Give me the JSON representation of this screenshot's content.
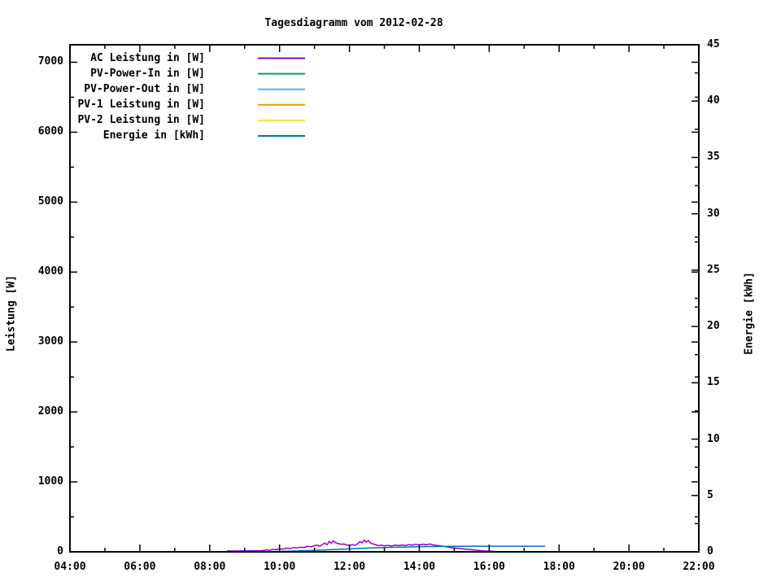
{
  "chart_data": {
    "type": "line",
    "title": "Tagesdiagramm vom 2012-02-28",
    "background": "#ffffff",
    "axis_color": "#000000",
    "grid": false,
    "legend_position": "top-left-inside",
    "x_axis": {
      "range": [
        4,
        22
      ],
      "tick_hours": [
        4,
        6,
        8,
        10,
        12,
        14,
        16,
        18,
        20,
        22
      ],
      "tick_labels": [
        "04:00",
        "06:00",
        "08:00",
        "10:00",
        "12:00",
        "14:00",
        "16:00",
        "18:00",
        "20:00",
        "22:00"
      ],
      "minor_step_hours": 1
    },
    "y_left": {
      "label": "Leistung [W]",
      "range": [
        0,
        7250
      ],
      "tick_values": [
        0,
        1000,
        2000,
        3000,
        4000,
        5000,
        6000,
        7000
      ],
      "tick_labels": [
        "0",
        "1000",
        "2000",
        "3000",
        "4000",
        "5000",
        "6000",
        "7000"
      ],
      "minor_step": 500
    },
    "y_right": {
      "label": "Energie [kWh]",
      "range": [
        0,
        45
      ],
      "tick_values": [
        0,
        5,
        10,
        15,
        20,
        25,
        30,
        35,
        40,
        45
      ],
      "tick_labels": [
        "0",
        "5",
        "10",
        "15",
        "20",
        "25",
        "30",
        "35",
        "40",
        "45"
      ],
      "minor_step": 2.5
    },
    "series": [
      {
        "name": "AC Leistung in [W]",
        "color": "#9400d3",
        "axis": "left",
        "points": [
          [
            8.5,
            15
          ],
          [
            8.7,
            12
          ],
          [
            8.9,
            15
          ],
          [
            9.1,
            13
          ],
          [
            9.3,
            16
          ],
          [
            9.45,
            14
          ],
          [
            9.55,
            20
          ],
          [
            9.65,
            28
          ],
          [
            9.72,
            22
          ],
          [
            9.8,
            35
          ],
          [
            9.9,
            30
          ],
          [
            10.0,
            42
          ],
          [
            10.1,
            38
          ],
          [
            10.2,
            52
          ],
          [
            10.3,
            46
          ],
          [
            10.4,
            60
          ],
          [
            10.5,
            55
          ],
          [
            10.6,
            68
          ],
          [
            10.7,
            62
          ],
          [
            10.8,
            78
          ],
          [
            10.9,
            72
          ],
          [
            11.0,
            88
          ],
          [
            11.08,
            95
          ],
          [
            11.15,
            82
          ],
          [
            11.22,
            105
          ],
          [
            11.3,
            125
          ],
          [
            11.36,
            100
          ],
          [
            11.42,
            148
          ],
          [
            11.48,
            122
          ],
          [
            11.54,
            158
          ],
          [
            11.6,
            132
          ],
          [
            11.68,
            118
          ],
          [
            11.76,
            108
          ],
          [
            11.84,
            112
          ],
          [
            11.92,
            98
          ],
          [
            12.0,
            92
          ],
          [
            12.08,
            102
          ],
          [
            12.16,
            92
          ],
          [
            12.24,
            118
          ],
          [
            12.3,
            148
          ],
          [
            12.36,
            128
          ],
          [
            12.42,
            168
          ],
          [
            12.48,
            138
          ],
          [
            12.54,
            162
          ],
          [
            12.6,
            128
          ],
          [
            12.68,
            112
          ],
          [
            12.76,
            98
          ],
          [
            12.84,
            88
          ],
          [
            12.92,
            95
          ],
          [
            13.0,
            85
          ],
          [
            13.1,
            92
          ],
          [
            13.2,
            82
          ],
          [
            13.3,
            95
          ],
          [
            13.4,
            88
          ],
          [
            13.5,
            98
          ],
          [
            13.6,
            92
          ],
          [
            13.7,
            102
          ],
          [
            13.8,
            95
          ],
          [
            13.9,
            108
          ],
          [
            14.0,
            98
          ],
          [
            14.1,
            108
          ],
          [
            14.2,
            100
          ],
          [
            14.3,
            112
          ],
          [
            14.4,
            98
          ],
          [
            14.5,
            92
          ],
          [
            14.6,
            85
          ],
          [
            14.7,
            78
          ],
          [
            14.8,
            70
          ],
          [
            14.9,
            62
          ],
          [
            15.0,
            55
          ],
          [
            15.15,
            48
          ],
          [
            15.3,
            40
          ],
          [
            15.45,
            32
          ],
          [
            15.6,
            25
          ],
          [
            15.75,
            18
          ],
          [
            15.9,
            12
          ],
          [
            16.05,
            8
          ],
          [
            16.2,
            5
          ],
          [
            16.4,
            4
          ],
          [
            16.7,
            3
          ],
          [
            17.0,
            3
          ],
          [
            17.3,
            2
          ]
        ]
      },
      {
        "name": "PV-Power-In in [W]",
        "color": "#009e73",
        "axis": "left",
        "points": [
          [
            8.5,
            0
          ],
          [
            17.3,
            0
          ]
        ]
      },
      {
        "name": "PV-Power-Out in [W]",
        "color": "#56b4e9",
        "axis": "left",
        "points": [
          [
            8.5,
            0
          ],
          [
            17.3,
            0
          ]
        ]
      },
      {
        "name": "PV-1 Leistung in [W]",
        "color": "#e69f00",
        "axis": "left",
        "points": [
          [
            8.5,
            0
          ],
          [
            17.3,
            0
          ]
        ]
      },
      {
        "name": "PV-2 Leistung in [W]",
        "color": "#f0e442",
        "axis": "left",
        "points": [
          [
            8.5,
            0
          ],
          [
            17.3,
            0
          ]
        ]
      },
      {
        "name": "Energie in [kWh]",
        "color": "#0072b2",
        "axis": "right",
        "points": [
          [
            9.25,
            0.0
          ],
          [
            9.6,
            0.01
          ],
          [
            9.9,
            0.03
          ],
          [
            10.2,
            0.05
          ],
          [
            10.5,
            0.08
          ],
          [
            10.8,
            0.11
          ],
          [
            11.1,
            0.14
          ],
          [
            11.4,
            0.18
          ],
          [
            11.7,
            0.22
          ],
          [
            12.0,
            0.26
          ],
          [
            12.3,
            0.3
          ],
          [
            12.6,
            0.34
          ],
          [
            12.9,
            0.37
          ],
          [
            13.2,
            0.4
          ],
          [
            13.5,
            0.42
          ],
          [
            13.8,
            0.44
          ],
          [
            14.1,
            0.46
          ],
          [
            14.4,
            0.47
          ],
          [
            14.7,
            0.48
          ],
          [
            15.0,
            0.49
          ],
          [
            15.4,
            0.5
          ],
          [
            17.6,
            0.5
          ]
        ]
      }
    ]
  }
}
